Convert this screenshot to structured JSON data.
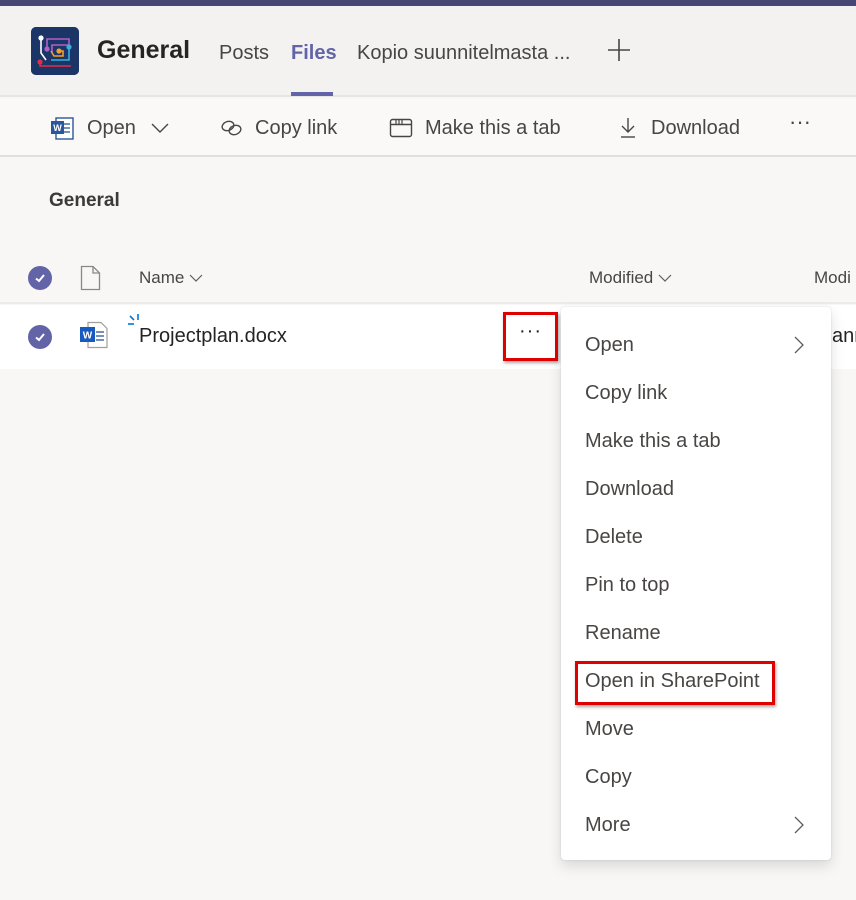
{
  "header": {
    "channel_title": "General",
    "tabs": [
      {
        "label": "Posts",
        "active": false
      },
      {
        "label": "Files",
        "active": true
      },
      {
        "label": "Kopio suunnitelmasta ...",
        "active": false
      }
    ],
    "add_tab_icon": "plus-icon",
    "accent_color": "#6264a7",
    "top_strip_color": "#464775"
  },
  "toolbar": {
    "open_label": "Open",
    "copy_link_label": "Copy link",
    "make_tab_label": "Make this a tab",
    "download_label": "Download",
    "more_label": "···"
  },
  "breadcrumb": "General",
  "columns": {
    "name": "Name",
    "modified": "Modified",
    "modified_by": "Modi"
  },
  "files": [
    {
      "name": "Projectplan.docx",
      "type": "word",
      "selected": true,
      "modified_by_partial": "ann"
    }
  ],
  "row_more_label": "···",
  "context_menu": {
    "items": [
      {
        "label": "Open",
        "submenu": true
      },
      {
        "label": "Copy link",
        "submenu": false
      },
      {
        "label": "Make this a tab",
        "submenu": false
      },
      {
        "label": "Download",
        "submenu": false
      },
      {
        "label": "Delete",
        "submenu": false
      },
      {
        "label": "Pin to top",
        "submenu": false
      },
      {
        "label": "Rename",
        "submenu": false
      },
      {
        "label": "Open in SharePoint",
        "submenu": false,
        "highlighted": true
      },
      {
        "label": "Move",
        "submenu": false
      },
      {
        "label": "Copy",
        "submenu": false
      },
      {
        "label": "More",
        "submenu": true
      }
    ]
  },
  "annotation_color": "#e00000"
}
